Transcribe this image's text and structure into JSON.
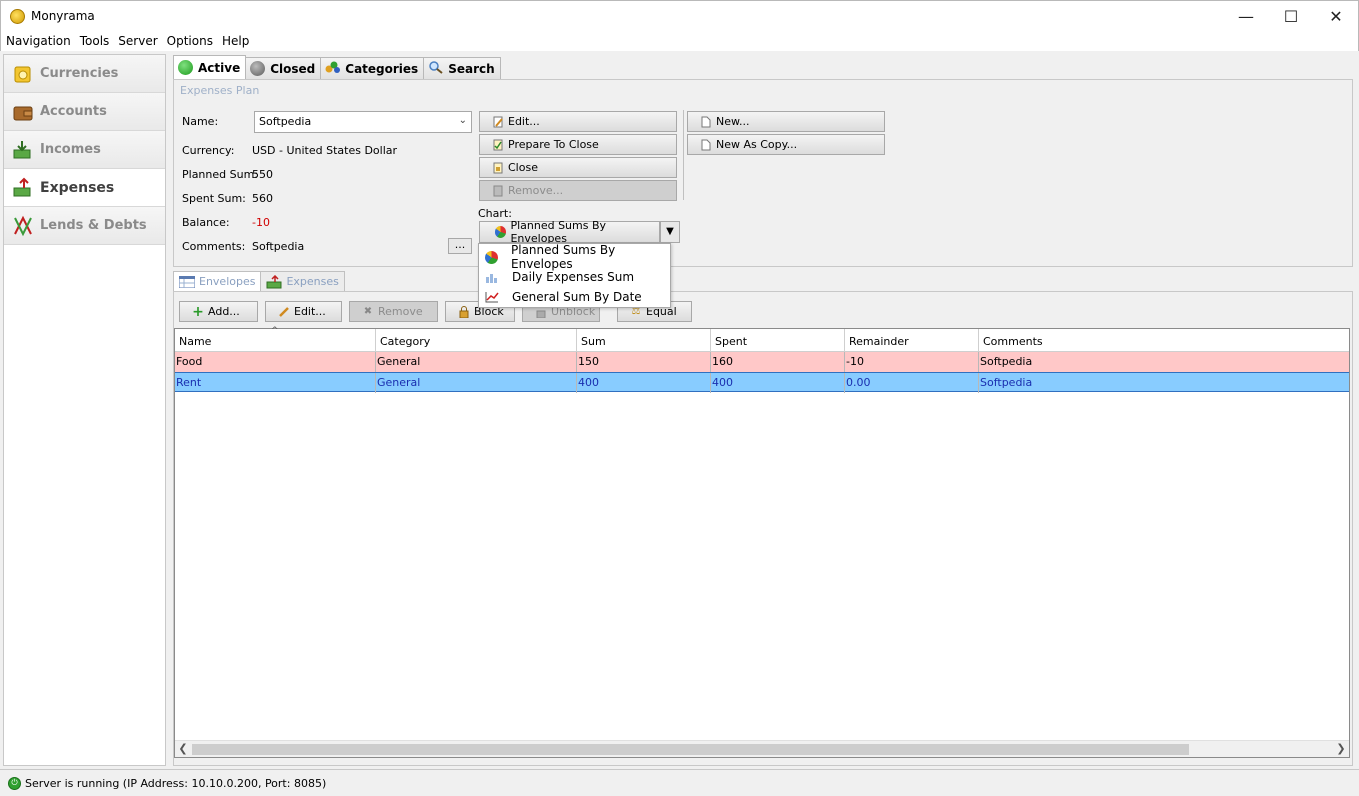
{
  "window": {
    "title": "Monyrama"
  },
  "menu": [
    "Navigation",
    "Tools",
    "Server",
    "Options",
    "Help"
  ],
  "nav": [
    {
      "label": "Currencies",
      "icon": "currencies-icon"
    },
    {
      "label": "Accounts",
      "icon": "wallet-icon"
    },
    {
      "label": "Incomes",
      "icon": "incomes-icon"
    },
    {
      "label": "Expenses",
      "icon": "expenses-icon",
      "active": true
    },
    {
      "label": "Lends & Debts",
      "icon": "lends-debts-icon"
    }
  ],
  "tabs": [
    {
      "label": "Active",
      "active": true
    },
    {
      "label": "Closed"
    },
    {
      "label": "Categories"
    },
    {
      "label": "Search"
    }
  ],
  "plan": {
    "legend": "Expenses Plan",
    "name_label": "Name:",
    "name_value": "Softpedia",
    "currency_label": "Currency:",
    "currency_value": "USD - United States Dollar",
    "planned_label": "Planned Sum:",
    "planned_value": "550",
    "spent_label": "Spent Sum:",
    "spent_value": "560",
    "balance_label": "Balance:",
    "balance_value": "-10",
    "comments_label": "Comments:",
    "comments_value": "Softpedia",
    "dots": "...",
    "buttons": {
      "edit": "Edit...",
      "prepare": "Prepare To Close",
      "close": "Close",
      "remove": "Remove...",
      "new": "New...",
      "new_copy": "New As Copy..."
    },
    "chart_label": "Chart:",
    "chart_selected": "Planned Sums By Envelopes",
    "chart_options": [
      "Planned Sums By Envelopes",
      "Daily Expenses Sum",
      "General Sum By Date"
    ]
  },
  "subtabs": [
    "Envelopes",
    "Expenses"
  ],
  "toolbar": {
    "add": "Add...",
    "edit": "Edit...",
    "remove": "Remove",
    "block": "Block",
    "unblock": "Unblock",
    "equal": "Equal"
  },
  "table": {
    "columns": [
      "Name",
      "Category",
      "Sum",
      "Spent",
      "Remainder",
      "Comments"
    ],
    "rows": [
      [
        "Food",
        "General",
        "150",
        "160",
        "-10",
        "Softpedia"
      ],
      [
        "Rent",
        "General",
        "400",
        "400",
        "0.00",
        "Softpedia"
      ]
    ]
  },
  "status": {
    "text": "Server is running (IP Address: 10.10.0.200, Port: 8085)"
  },
  "colors": {
    "overspent_row": "#ffc8c8",
    "selected_row": "#88ccff",
    "negative": "#d00000"
  }
}
